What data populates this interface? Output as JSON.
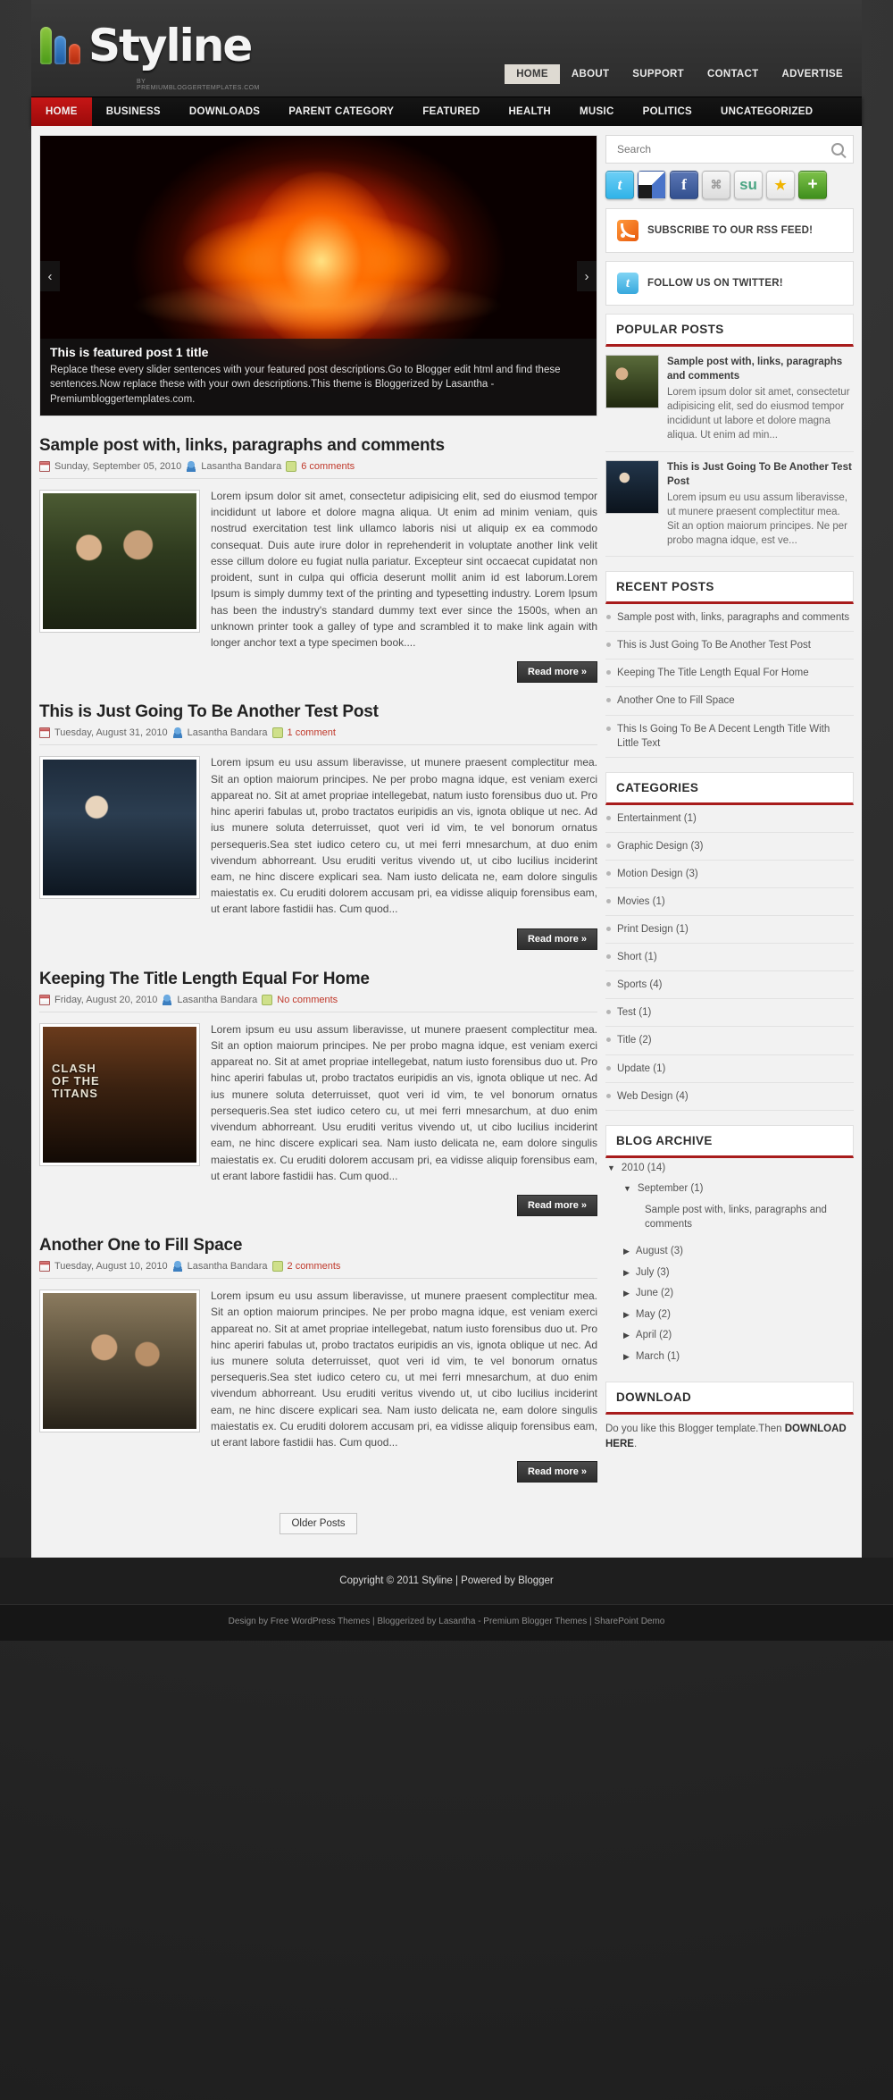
{
  "site": {
    "logo_text": "Styline",
    "logo_subtitle": "BY PREMIUMBLOGGERTEMPLATES.COM"
  },
  "top_nav": [
    {
      "label": "HOME",
      "active": true
    },
    {
      "label": "ABOUT",
      "active": false
    },
    {
      "label": "SUPPORT",
      "active": false
    },
    {
      "label": "CONTACT",
      "active": false
    },
    {
      "label": "ADVERTISE",
      "active": false
    }
  ],
  "main_nav": [
    {
      "label": "HOME",
      "active": true
    },
    {
      "label": "BUSINESS",
      "active": false
    },
    {
      "label": "DOWNLOADS",
      "active": false
    },
    {
      "label": "PARENT CATEGORY",
      "active": false
    },
    {
      "label": "FEATURED",
      "active": false
    },
    {
      "label": "HEALTH",
      "active": false
    },
    {
      "label": "MUSIC",
      "active": false
    },
    {
      "label": "POLITICS",
      "active": false
    },
    {
      "label": "UNCATEGORIZED",
      "active": false
    }
  ],
  "slider": {
    "title": "This is featured post 1 title",
    "description": "Replace these every slider sentences with your featured post descriptions.Go to Blogger edit html and find these sentences.Now replace these with your own descriptions.This theme is Bloggerized by Lasantha - Premiumbloggertemplates.com.",
    "prev_label": "‹",
    "next_label": "›"
  },
  "posts": [
    {
      "title": "Sample post with, links, paragraphs and comments",
      "date": "Sunday, September 05, 2010",
      "author": "Lasantha Bandara",
      "comments": "6 comments",
      "body": "Lorem ipsum dolor sit amet, consectetur adipisicing elit, sed do eiusmod tempor incididunt ut labore et dolore magna aliqua. Ut enim ad minim veniam, quis nostrud exercitation test link ullamco laboris nisi ut aliquip ex ea commodo consequat. Duis aute irure dolor in reprehenderit in voluptate another link velit esse cillum dolore eu fugiat nulla pariatur. Excepteur sint occaecat cupidatat non proident, sunt in culpa qui officia deserunt mollit anim id est laborum.Lorem Ipsum is simply dummy text of the printing and typesetting industry. Lorem Ipsum has been the industry's standard dummy text ever since the 1500s, when an unknown printer took a galley of type and scrambled it to make link again with longer anchor text a type specimen book....",
      "read_more": "Read more »"
    },
    {
      "title": "This is Just Going To Be Another Test Post",
      "date": "Tuesday, August 31, 2010",
      "author": "Lasantha Bandara",
      "comments": "1 comment",
      "body": "Lorem ipsum eu usu assum liberavisse, ut munere praesent complectitur mea. Sit an option maiorum principes. Ne per probo magna idque, est veniam exerci appareat no. Sit at amet propriae intellegebat, natum iusto forensibus duo ut. Pro hinc aperiri fabulas ut, probo tractatos euripidis an vis, ignota oblique ut nec. Ad ius munere soluta deterruisset, quot veri id vim, te vel bonorum ornatus persequeris.Sea stet iudico cetero cu, ut mei ferri mnesarchum, at duo enim vivendum abhorreant. Usu eruditi veritus vivendo ut, ut cibo lucilius inciderint eam, ne hinc discere explicari sea. Nam iusto delicata ne, eam dolore singulis maiestatis ex. Cu eruditi dolorem accusam pri, ea vidisse aliquip forensibus eam, ut erant labore fastidii has. Cum quod...",
      "read_more": "Read more »"
    },
    {
      "title": "Keeping The Title Length Equal For Home",
      "date": "Friday, August 20, 2010",
      "author": "Lasantha Bandara",
      "comments": "No comments",
      "body": "Lorem ipsum eu usu assum liberavisse, ut munere praesent complectitur mea. Sit an option maiorum principes. Ne per probo magna idque, est veniam exerci appareat no. Sit at amet propriae intellegebat, natum iusto forensibus duo ut. Pro hinc aperiri fabulas ut, probo tractatos euripidis an vis, ignota oblique ut nec. Ad ius munere soluta deterruisset, quot veri id vim, te vel bonorum ornatus persequeris.Sea stet iudico cetero cu, ut mei ferri mnesarchum, at duo enim vivendum abhorreant. Usu eruditi veritus vivendo ut, ut cibo lucilius inciderint eam, ne hinc discere explicari sea. Nam iusto delicata ne, eam dolore singulis maiestatis ex. Cu eruditi dolorem accusam pri, ea vidisse aliquip forensibus eam, ut erant labore fastidii has. Cum quod...",
      "read_more": "Read more »"
    },
    {
      "title": "Another One to Fill Space",
      "date": "Tuesday, August 10, 2010",
      "author": "Lasantha Bandara",
      "comments": "2 comments",
      "body": "Lorem ipsum eu usu assum liberavisse, ut munere praesent complectitur mea. Sit an option maiorum principes. Ne per probo magna idque, est veniam exerci appareat no. Sit at amet propriae intellegebat, natum iusto forensibus duo ut. Pro hinc aperiri fabulas ut, probo tractatos euripidis an vis, ignota oblique ut nec. Ad ius munere soluta deterruisset, quot veri id vim, te vel bonorum ornatus persequeris.Sea stet iudico cetero cu, ut mei ferri mnesarchum, at duo enim vivendum abhorreant. Usu eruditi veritus vivendo ut, ut cibo lucilius inciderint eam, ne hinc discere explicari sea. Nam iusto delicata ne, eam dolore singulis maiestatis ex. Cu eruditi dolorem accusam pri, ea vidisse aliquip forensibus eam, ut erant labore fastidii has. Cum quod...",
      "read_more": "Read more »"
    }
  ],
  "pagination": {
    "older_posts": "Older Posts"
  },
  "sidebar": {
    "search": {
      "placeholder": "Search",
      "value": "",
      "icon": "search-icon"
    },
    "social": [
      {
        "name": "twitter-icon",
        "glyph": "t"
      },
      {
        "name": "delicious-icon",
        "glyph": ""
      },
      {
        "name": "facebook-icon",
        "glyph": "f"
      },
      {
        "name": "google-buzz-icon",
        "glyph": "⌘"
      },
      {
        "name": "stumbleupon-icon",
        "glyph": "su"
      },
      {
        "name": "favorites-star-icon",
        "glyph": "★"
      },
      {
        "name": "add-share-icon",
        "glyph": "+"
      }
    ],
    "rss_banner": "SUBSCRIBE TO OUR RSS FEED!",
    "twitter_banner": "FOLLOW US ON TWITTER!",
    "popular_posts": {
      "title": "POPULAR POSTS",
      "items": [
        {
          "title": "Sample post with, links, paragraphs and comments",
          "excerpt": "Lorem ipsum dolor sit amet, consectetur adipisicing elit, sed do eiusmod tempor incididunt ut labore et dolore magna aliqua. Ut enim ad min..."
        },
        {
          "title": "This is Just Going To Be Another Test Post",
          "excerpt": "Lorem ipsum eu usu assum liberavisse, ut munere praesent complectitur mea. Sit an option maiorum principes. Ne per probo magna idque, est ve..."
        }
      ]
    },
    "recent_posts": {
      "title": "RECENT POSTS",
      "items": [
        "Sample post with, links, paragraphs and comments",
        "This is Just Going To Be Another Test Post",
        "Keeping The Title Length Equal For Home",
        "Another One to Fill Space",
        "This Is Going To Be A Decent Length Title With Little Text"
      ]
    },
    "categories": {
      "title": "CATEGORIES",
      "items": [
        "Entertainment (1)",
        "Graphic Design (3)",
        "Motion Design (3)",
        "Movies (1)",
        "Print Design (1)",
        "Short (1)",
        "Sports (4)",
        "Test (1)",
        "Title (2)",
        "Update (1)",
        "Web Design (4)"
      ]
    },
    "blog_archive": {
      "title": "BLOG ARCHIVE",
      "year": "2010 (14)",
      "year_marker": "▼",
      "month_open": "September (1)",
      "month_open_marker": "▼",
      "month_post": "Sample post with, links, paragraphs and comments",
      "months": [
        {
          "label": "August (3)",
          "marker": "▶"
        },
        {
          "label": "July (3)",
          "marker": "▶"
        },
        {
          "label": "June (2)",
          "marker": "▶"
        },
        {
          "label": "May (2)",
          "marker": "▶"
        },
        {
          "label": "April (2)",
          "marker": "▶"
        },
        {
          "label": "March (1)",
          "marker": "▶"
        }
      ]
    },
    "download": {
      "title": "DOWNLOAD",
      "text": "Do you like this Blogger template.Then ",
      "link": "DOWNLOAD HERE",
      "tail": "."
    }
  },
  "footer": {
    "copyright": "Copyright © 2011 Styline | Powered by Blogger",
    "credits": "Design by Free WordPress Themes | Bloggerized by Lasantha - Premium Blogger Themes | SharePoint Demo"
  },
  "colors": {
    "accent_red": "#a81c1c",
    "nav_active_red": "#c61616",
    "link_red": "#c0392b"
  }
}
